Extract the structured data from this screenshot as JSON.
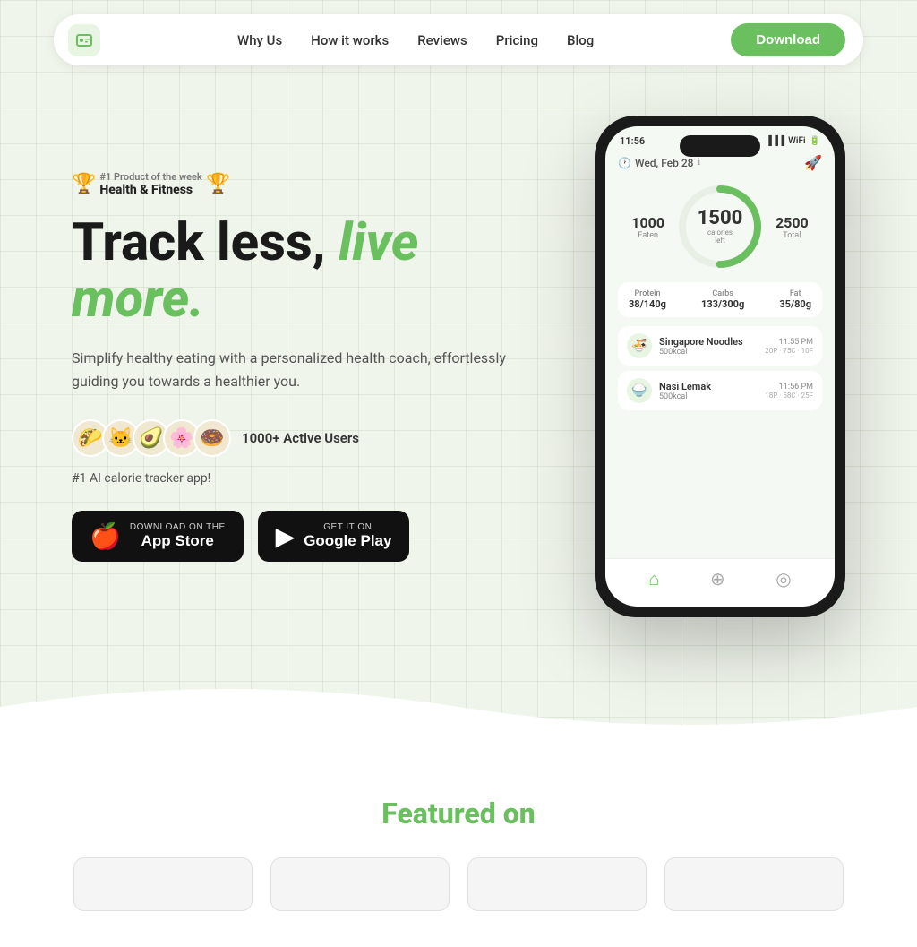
{
  "nav": {
    "logo_emoji": "🤖",
    "links": [
      "Why Us",
      "How it works",
      "Reviews",
      "Pricing",
      "Blog"
    ],
    "download_label": "Download"
  },
  "hero": {
    "badge": {
      "number": "#1",
      "label": "Product of the week",
      "category": "Health & Fitness"
    },
    "headline_part1": "Track less,",
    "headline_part2": "live more.",
    "description": "Simplify healthy eating with a personalized health coach, effortlessly guiding you towards a healthier you.",
    "active_users_count": "1000+ Active Users",
    "tagline": "#1 AI calorie tracker app!",
    "avatars": [
      "🌮",
      "🐱",
      "🥑",
      "🌸",
      "🍩"
    ],
    "app_store": {
      "small": "Download on the",
      "big": "App Store"
    },
    "google_play": {
      "small": "GET IT ON",
      "big": "Google Play"
    }
  },
  "phone": {
    "time": "11:56",
    "date": "Wed, Feb 28",
    "calories_eaten": "1000",
    "calories_eaten_label": "Eaten",
    "calories_left": "1500",
    "calories_left_label": "calories\nleft",
    "calories_total": "2500",
    "calories_total_label": "Total",
    "macros": [
      {
        "name": "Protein",
        "value": "38/140g"
      },
      {
        "name": "Carbs",
        "value": "133/300g"
      },
      {
        "name": "Fat",
        "value": "35/80g"
      }
    ],
    "foods": [
      {
        "name": "Singapore Noodles",
        "calories": "500kcal",
        "time": "11:55 PM",
        "macros": "20P · 75C · 10F",
        "emoji": "🍜"
      },
      {
        "name": "Nasi Lemak",
        "calories": "500kcal",
        "time": "11:56 PM",
        "macros": "18P · 58C · 25F",
        "emoji": "🍚"
      }
    ]
  },
  "featured": {
    "title_highlight": "Featured",
    "title_rest": "on"
  }
}
